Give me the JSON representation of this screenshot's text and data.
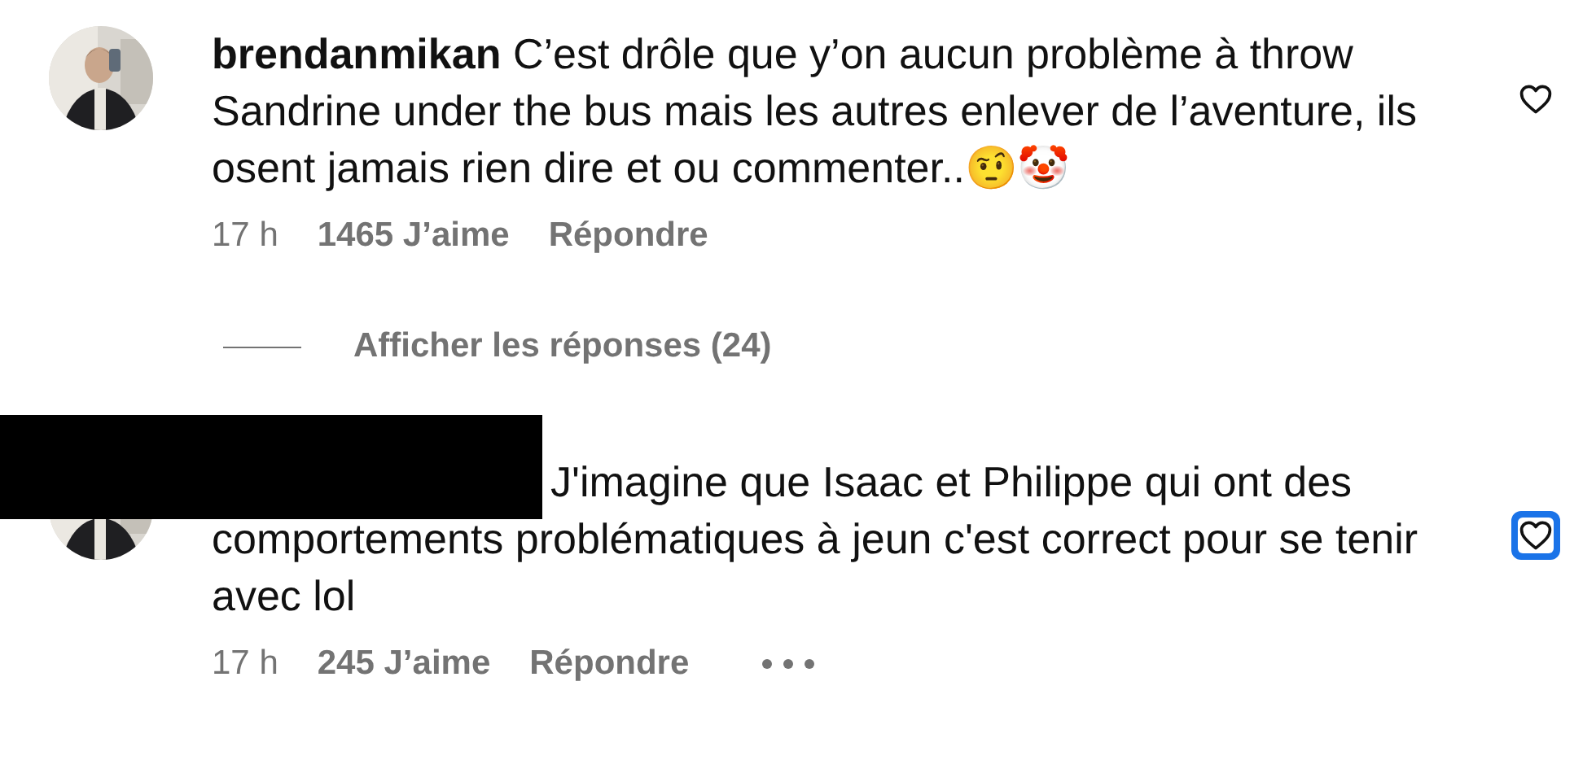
{
  "comments": [
    {
      "username": "brendanmikan",
      "text": "C’est drôle que y’on aucun problème à throw Sandrine under the bus mais les autres enlever de l’aventure, ils osent jamais rien dire et ou commenter..🤨🤡",
      "time": "17 h",
      "likes": "1465 J’aime",
      "reply": "Répondre",
      "redacted": false,
      "more": false,
      "like_focused": false,
      "replies": "Afficher les réponses (24)"
    },
    {
      "text": "J'imagine que Isaac et Philippe qui ont des comportements problématiques à jeun c'est correct pour se tenir avec lol",
      "time": "17 h",
      "likes": "245 J’aime",
      "reply": "Répondre",
      "redacted": true,
      "more": true,
      "like_focused": true
    }
  ]
}
